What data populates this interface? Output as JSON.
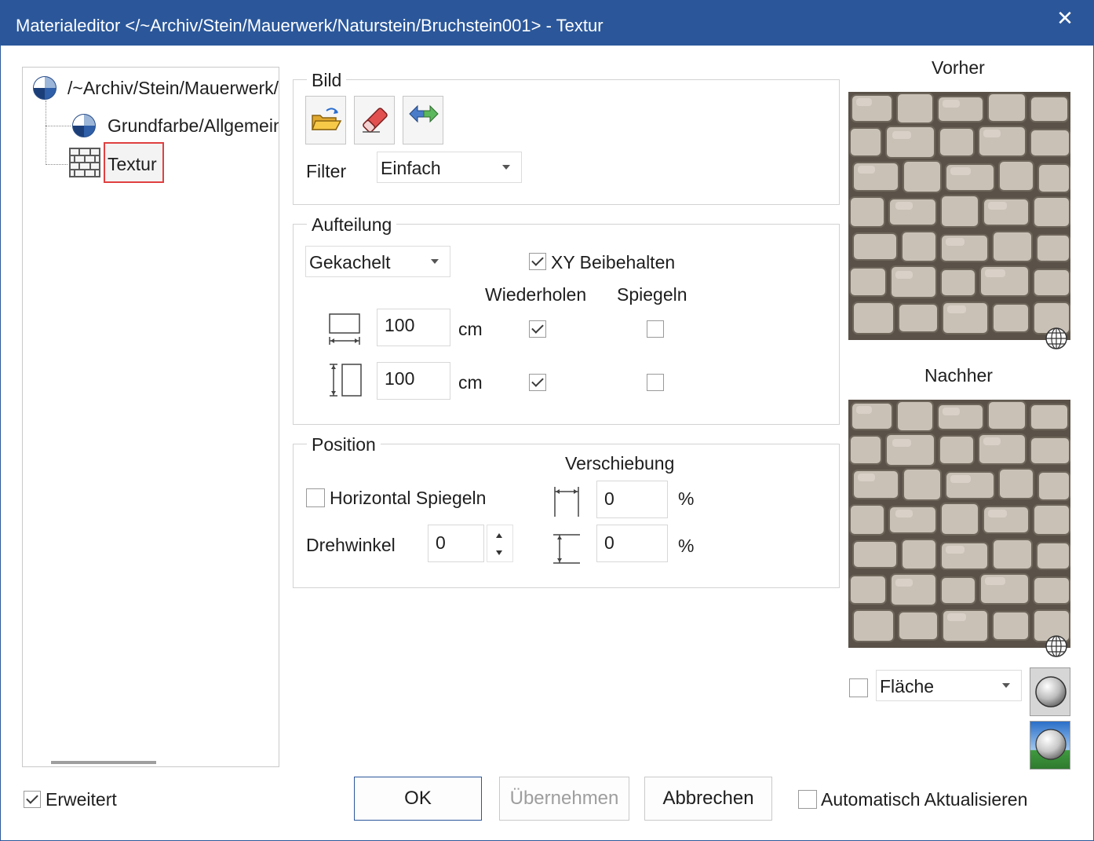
{
  "window": {
    "title": "Materialeditor   </~Archiv/Stein/Mauerwerk/Naturstein/Bruchstein001>  - Textur",
    "close_glyph": "✕"
  },
  "tree": {
    "items": [
      {
        "label": "/~Archiv/Stein/Mauerwerk/Naturstein",
        "icon": "material-sphere-icon"
      },
      {
        "label": "Grundfarbe/Allgemein",
        "icon": "material-sphere-icon"
      },
      {
        "label": "Textur",
        "icon": "brick-wall-icon",
        "selected": true
      }
    ]
  },
  "bild": {
    "group_title": "Bild",
    "toolbar": [
      "open-folder-icon",
      "eraser-icon",
      "swap-arrows-icon"
    ],
    "filter_label": "Filter",
    "filter_value": "Einfach"
  },
  "aufteilung": {
    "group_title": "Aufteilung",
    "mode_value": "Gekachelt",
    "xy_keep_label": "XY Beibehalten",
    "xy_keep_checked": true,
    "col_repeat": "Wiederholen",
    "col_mirror": "Spiegeln",
    "rows": [
      {
        "icon": "width-icon",
        "value": "100",
        "unit": "cm",
        "repeat": true,
        "mirror": false
      },
      {
        "icon": "height-icon",
        "value": "100",
        "unit": "cm",
        "repeat": true,
        "mirror": false
      }
    ]
  },
  "position": {
    "group_title": "Position",
    "hmirror_label": "Horizontal Spiegeln",
    "hmirror_checked": false,
    "shift_label": "Verschiebung",
    "rotation_label": "Drehwinkel",
    "rotation_value": "0",
    "shift_x": "0",
    "shift_y": "0",
    "percent": "%"
  },
  "preview": {
    "before_label": "Vorher",
    "after_label": "Nachher",
    "shape_value": "Fläche",
    "shape_checked": false
  },
  "footer": {
    "extended_label": "Erweitert",
    "extended_checked": true,
    "ok_label": "OK",
    "apply_label": "Übernehmen",
    "cancel_label": "Abbrechen",
    "auto_update_label": "Automatisch Aktualisieren",
    "auto_update_checked": false
  },
  "colors": {
    "titlebar": "#2b579a",
    "selection_outline": "#e04040"
  }
}
